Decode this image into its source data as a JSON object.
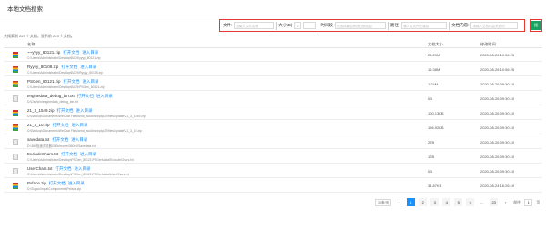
{
  "window": {
    "title": "本地文档搜索"
  },
  "filters": {
    "file_name_label": "文件:",
    "file_name_placeholder": "请输入文件名称",
    "size_label": "大小(B)",
    "size_compare_value": "≥",
    "time_label": "时间段",
    "time_placeholder": "请选择最后修改日期范围",
    "path_label": "路径:",
    "path_placeholder": "输入文件所在路径",
    "content_label": "文档内容:",
    "content_placeholder": "请输入文档内容关键词",
    "search_button": "搜"
  },
  "summary": "共搜索到 223 个文档，显示前 223 个文档。",
  "table": {
    "columns": [
      "名称",
      "文档大小",
      "修改时间"
    ],
    "open_file_label": "打开文档",
    "open_dir_label": "进入目录",
    "rows": [
      {
        "icon": "archive-icon",
        "name": "~~yyyy_80121.zip",
        "path": "C:\\Users\\Administrator\\Desktop\\BJ29\\yyyy_80121.zip",
        "size": "26.29M",
        "date": "2020-08-26 10:56:25"
      },
      {
        "icon": "archive-icon",
        "name": "Ryyyy_80108.zip",
        "path": "C:\\Users\\Administrator\\Desktop\\BJ29\\Ryyyy_80108.zip",
        "size": "16.38M",
        "date": "2020-08-26 10:56:25"
      },
      {
        "icon": "archive-icon",
        "name": "PSGen_80121.zip",
        "path": "C:\\Users\\Administrator\\Desktop\\BJ29\\PSGen_80121.zip",
        "size": "1.24M",
        "date": "2020-08-26 09:30:10"
      },
      {
        "icon": "document-icon",
        "name": "enginedata_debug_bin.txt",
        "path": "D:\\Dev\\bin\\enginedata_debug_bin.txt",
        "size": "0B",
        "date": "2020-08-26 09:30:10"
      },
      {
        "icon": "archive-icon",
        "name": "21_3_1549.zip",
        "path": "D:\\Backup\\Documents\\WeChat Files\\wxid_aoo5xwwp4p22\\files\\update\\21_3_1549.zip",
        "size": "100.13KB",
        "date": "2020-08-26 09:30:10"
      },
      {
        "icon": "archive-icon",
        "name": "21_3_10.zip",
        "path": "D:\\Backup\\Documents\\WeChat Files\\wxid_aoo5xwwp4p22\\files\\update\\21_3_10.zip",
        "size": "156.92KB",
        "date": "2020-08-26 09:30:10"
      },
      {
        "icon": "document-icon",
        "name": "savedata.txt",
        "path": "D:\\360极速浏览器\\360chrome\\360rsl\\Savedata.txt",
        "size": "27B",
        "date": "2020-08-26 09:30:10"
      },
      {
        "icon": "document-icon",
        "name": "ExcludeChars.txt",
        "path": "C:\\Users\\Administrator\\Desktop\\PSGen_80121\\PSGen\\data\\ExcludeChars.txt",
        "size": "12B",
        "date": "2020-08-26 09:30:10"
      },
      {
        "icon": "document-icon",
        "name": "UserChars.txt",
        "path": "C:\\Users\\Administrator\\Desktop\\PSGen_80121\\PSGen\\data\\UserChars.txt",
        "size": "0B",
        "date": "2020-08-26 09:30:10"
      },
      {
        "icon": "archive-icon",
        "name": "Pxface.zip",
        "path": "D:\\Sogou\\input\\Components\\Pxface.zip",
        "size": "34.87KB",
        "date": "2020-08-24 16:26:19"
      }
    ]
  },
  "pagination": {
    "page_size": "10条/页",
    "prev": "‹",
    "pages": [
      "1",
      "2",
      "3",
      "4",
      "5",
      "6",
      "…",
      "23"
    ],
    "active_page": "1",
    "next": "›",
    "goto_prefix": "前往",
    "goto_value": "1",
    "goto_suffix": "页"
  }
}
